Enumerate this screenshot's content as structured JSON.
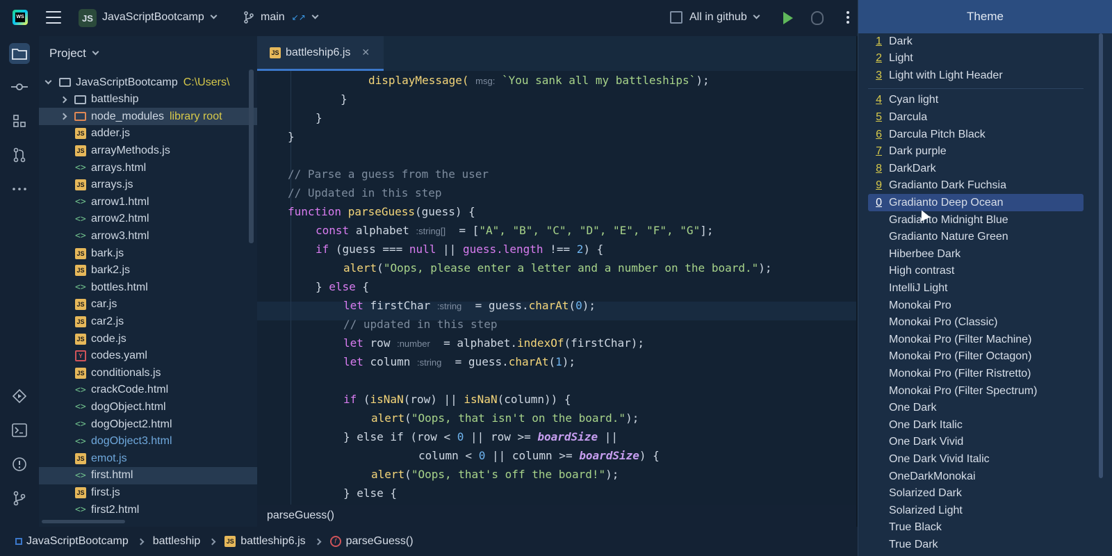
{
  "toolbar": {
    "project_badge": "JS",
    "project_name": "JavaScriptBootcamp",
    "branch": "main",
    "branch_arrows": "↙↗",
    "run_config": "All in github"
  },
  "project_panel": {
    "title": "Project",
    "tree": [
      {
        "label": "JavaScriptBootcamp",
        "hint": "C:\\Users\\",
        "kind": "folder-root"
      },
      {
        "label": "battleship",
        "kind": "folder"
      },
      {
        "label": "node_modules",
        "hint": "library root",
        "kind": "folder-lib"
      },
      {
        "label": "adder.js",
        "kind": "js"
      },
      {
        "label": "arrayMethods.js",
        "kind": "js"
      },
      {
        "label": "arrays.html",
        "kind": "html"
      },
      {
        "label": "arrays.js",
        "kind": "js"
      },
      {
        "label": "arrow1.html",
        "kind": "html"
      },
      {
        "label": "arrow2.html",
        "kind": "html"
      },
      {
        "label": "arrow3.html",
        "kind": "html"
      },
      {
        "label": "bark.js",
        "kind": "js"
      },
      {
        "label": "bark2.js",
        "kind": "js"
      },
      {
        "label": "bottles.html",
        "kind": "html"
      },
      {
        "label": "car.js",
        "kind": "js"
      },
      {
        "label": "car2.js",
        "kind": "js"
      },
      {
        "label": "code.js",
        "kind": "js"
      },
      {
        "label": "codes.yaml",
        "kind": "yaml"
      },
      {
        "label": "conditionals.js",
        "kind": "js"
      },
      {
        "label": "crackCode.html",
        "kind": "html"
      },
      {
        "label": "dogObject.html",
        "kind": "html"
      },
      {
        "label": "dogObject2.html",
        "kind": "html"
      },
      {
        "label": "dogObject3.html",
        "kind": "html"
      },
      {
        "label": "emot.js",
        "kind": "js"
      },
      {
        "label": "first.html",
        "kind": "html"
      },
      {
        "label": "first.js",
        "kind": "js"
      },
      {
        "label": "first2.html",
        "kind": "html"
      }
    ]
  },
  "editor": {
    "tab_label": "battleship6.js",
    "tab_icon": "JS",
    "hints": {
      "msg": "msg:",
      "string_arr": ":string[]",
      "string": ":string",
      "number": ":number"
    },
    "code": {
      "l1_fn": "displayMessage(",
      "l1_str": "`You sank all my battleships`",
      "l1_end": ");",
      "brace": "}",
      "cm1": "// Parse a guess from the user",
      "cm2": "// Updated in this step",
      "fn_kw": "function",
      "fn_name": "parseGuess",
      "fn_args": "(guess) {",
      "const_kw": "const",
      "alphabet": "alphabet",
      "alpha_val_open": "= [",
      "alpha_letters": "\"A\", \"B\", \"C\", \"D\", \"E\", \"F\", \"G\"",
      "alpha_close": "];",
      "if_kw": "if",
      "if_cond1": "(guess === ",
      "null_kw": "null",
      "if_cond2": " || ",
      "guess": "guess",
      "length_prop": ".length",
      "neq": " !== ",
      "two": "2",
      "if_end": ") {",
      "alert_fn": "alert",
      "alert1_str": "\"Oops, please enter a letter and a number on the board.\"",
      "paren_end": ");",
      "else_kw": "else",
      "else_open": "} ",
      "else_end": " {",
      "let_kw": "let",
      "firstChar": "firstChar",
      "eq_guess": "= guess.",
      "charAt": "charAt",
      "zero": "0",
      "one": "1",
      "cm3": "// updated in this step",
      "row": "row",
      "eq_alpha": "= alphabet.",
      "indexOf": "indexOf",
      "idx_arg": "(firstChar);",
      "column": "column",
      "isNaN": "isNaN",
      "isnan_row": "(row) || ",
      "isnan_col": "(column)) {",
      "alert2_str": "\"Oops, that isn't on the board.\"",
      "elseif_open": "} else if (row < ",
      "or_row": " || row >= ",
      "boardSize": "boardSize",
      "or_tail": " ||",
      "col_lt": "column < ",
      "or_col": " || column >= ",
      "close_open": ") {",
      "alert3_str": "\"Oops, that's off the board!\"",
      "last_line": "} else {"
    }
  },
  "breadcrumb_bar": {
    "label": "parseGuess()"
  },
  "navbar": {
    "items": [
      "JavaScriptBootcamp",
      "battleship",
      "battleship6.js",
      "parseGuess()"
    ],
    "js_icon": "JS",
    "f_icon": "f"
  },
  "theme_popup": {
    "title": "Theme",
    "items": [
      {
        "num": "1",
        "label": "Dark"
      },
      {
        "num": "2",
        "label": "Light"
      },
      {
        "num": "3",
        "label": "Light with Light Header"
      },
      {
        "num": "4",
        "label": "Cyan light"
      },
      {
        "num": "5",
        "label": "Darcula"
      },
      {
        "num": "6",
        "label": "Darcula Pitch Black"
      },
      {
        "num": "7",
        "label": "Dark purple"
      },
      {
        "num": "8",
        "label": "DarkDark"
      },
      {
        "num": "9",
        "label": "Gradianto Dark Fuchsia"
      },
      {
        "num": "0",
        "label": "Gradianto Deep Ocean",
        "selected": true
      },
      {
        "num": "",
        "label": "Gradianto Midnight Blue"
      },
      {
        "num": "",
        "label": "Gradianto Nature Green"
      },
      {
        "num": "",
        "label": "Hiberbee Dark"
      },
      {
        "num": "",
        "label": "High contrast"
      },
      {
        "num": "",
        "label": "IntelliJ Light"
      },
      {
        "num": "",
        "label": "Monokai Pro"
      },
      {
        "num": "",
        "label": "Monokai Pro (Classic)"
      },
      {
        "num": "",
        "label": "Monokai Pro (Filter Machine)"
      },
      {
        "num": "",
        "label": "Monokai Pro (Filter Octagon)"
      },
      {
        "num": "",
        "label": "Monokai Pro (Filter Ristretto)"
      },
      {
        "num": "",
        "label": "Monokai Pro (Filter Spectrum)"
      },
      {
        "num": "",
        "label": "One Dark"
      },
      {
        "num": "",
        "label": "One Dark Italic"
      },
      {
        "num": "",
        "label": "One Dark Vivid"
      },
      {
        "num": "",
        "label": "One Dark Vivid Italic"
      },
      {
        "num": "",
        "label": "OneDarkMonokai"
      },
      {
        "num": "",
        "label": "Solarized Dark"
      },
      {
        "num": "",
        "label": "Solarized Light"
      },
      {
        "num": "",
        "label": "True Black"
      },
      {
        "num": "",
        "label": "True Dark"
      }
    ]
  },
  "colors": {
    "accent": "#2e4a82",
    "background": "#132233",
    "hint_yellow": "#d7c94a"
  }
}
